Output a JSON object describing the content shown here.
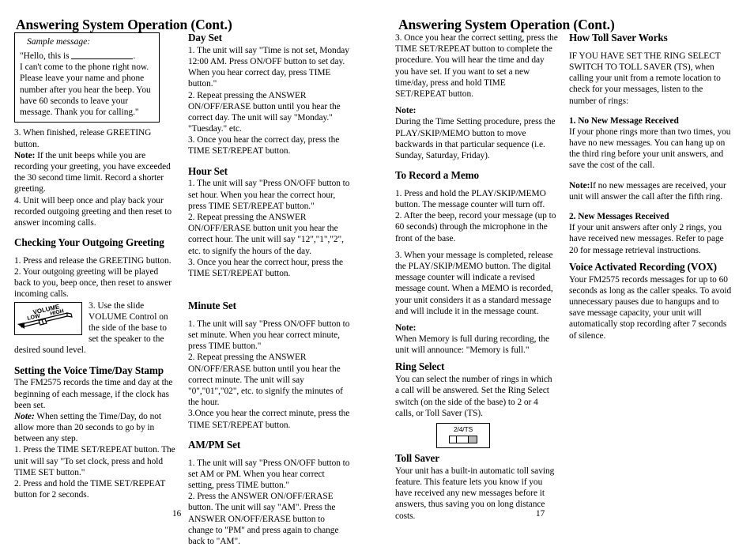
{
  "spread": {
    "left_page": {
      "title": "Answering System Operation (Cont.)",
      "page_number": "16",
      "sample_box": {
        "label": "Sample message:",
        "line1_prefix": "\"Hello, this is ",
        "line1_suffix": ".",
        "body": "I can't come to the phone right now. Please leave your name and phone number after you hear the beep. You have 60 seconds to leave your message. Thank you for calling.\""
      },
      "col1": {
        "step3": "3. When finished, release GREETING button.",
        "note_label": "Note:",
        "note_text": " If the unit beeps while you are recording your greeting, you have exceeded the 30 second time limit. Record a shorter greeting.",
        "step4": "4. Unit will beep once and play back your recorded outgoing greeting and then reset to answer incoming calls.",
        "heading_checking": "Checking Your Outgoing Greeting",
        "check_step1": "1. Press and release the GREETING button.",
        "check_step2": "2. Your outgoing greeting will be played back to you, beep once, then reset to answer incoming calls.",
        "check_step3": "3. Use the slide VOLUME Control on the side of the base to set the speaker to the desired sound level.",
        "volume_figure": {
          "title": "VOLUME",
          "low": "LOW",
          "high": "HIGH"
        },
        "heading_timestamp": "Setting the Voice Time/Day Stamp",
        "ts_intro": "The FM2575 records the time and day at the beginning of each message, if the clock has been set.",
        "ts_note_label": "Note:",
        "ts_note_text": " When setting the Time/Day, do not allow more than 20 seconds to go by in between any step.",
        "ts_step1": "1. Press the TIME SET/REPEAT button. The unit will say \"To set clock, press and hold TIME SET button.\"",
        "ts_step2": "2. Press and hold the TIME SET/REPEAT button for 2 seconds."
      },
      "col2": {
        "heading_day": "Day Set",
        "day_step1": "1.  The unit will say \"Time is not set, Monday 12:00 AM. Press ON/OFF button to set day. When you hear correct day, press TIME button.\"",
        "day_step2": "2. Repeat pressing the ANSWER ON/OFF/ERASE button until you hear the correct day. The unit will say \"Monday.\" \"Tuesday.\" etc.",
        "day_step3": "3. Once you hear the correct day, press the TIME SET/REPEAT button.",
        "heading_hour": "Hour Set",
        "hour_step1": "1. The unit will say \"Press ON/OFF button to set hour. When you hear the correct hour, press TIME SET/REPEAT button.\"",
        "hour_step2": "2. Repeat pressing the ANSWER ON/OFF/ERASE button unit you hear the correct hour. The unit will say \"12\",\"1\",\"2\", etc. to signify the hours of the day.",
        "hour_step3": "3. Once you hear the correct hour, press the TIME SET/REPEAT button.",
        "heading_minute": "Minute Set",
        "minute_step1": "1. The unit will say \"Press ON/OFF button to set minute. When you hear correct minute, press TIME button.\"",
        "minute_step2": "2. Repeat pressing the ANSWER ON/OFF/ERASE button until you hear the correct minute. The unit will say \"0\",\"01\",\"02\", etc. to signify the minutes of the hour.",
        "minute_step3": "3.Once you hear the correct minute, press the TIME SET/REPEAT button.",
        "heading_ampm": "AM/PM Set",
        "ampm_step1": "1. The unit will say \"Press ON/OFF button to set AM or PM. When you hear correct setting, press TIME button.\"",
        "ampm_step2": "2. Press the ANSWER ON/OFF/ERASE button. The unit will say \"AM\". Press the ANSWER ON/OFF/ERASE button to change to \"PM\" and press again to change back to \"AM\"."
      }
    },
    "right_page": {
      "title": "Answering System Operation (Cont.)",
      "page_number": "17",
      "col3": {
        "step3": "3. Once you hear the correct setting, press the TIME SET/REPEAT button to complete the procedure. You will hear the time and day you have set. If you want to set a new time/day, press and hold TIME SET/REPEAT button.",
        "note_label": "Note:",
        "note_text": "During the Time Setting procedure, press the PLAY/SKIP/MEMO button to move backwards in that particular sequence (i.e. Sunday, Saturday, Friday).",
        "heading_memo": "To Record a Memo",
        "memo_step1": "1.  Press and hold the PLAY/SKIP/MEMO button. The message counter will turn off.",
        "memo_step2": "2.  After the beep, record your message (up to 60 seconds) through the microphone in the front of the base.",
        "memo_step3": "3.  When your message is completed, release the PLAY/SKIP/MEMO button. The digital message counter will indicate a revised message count. When a MEMO is recorded, your unit considers it as a standard message and will include it in the message count.",
        "memo_note_label": "Note:",
        "memo_note_text": "When Memory is full during recording, the unit will announce: \"Memory is full.\"",
        "heading_ring": "Ring Select",
        "ring_text": "You can select the number of rings in which a call will be answered.  Set the Ring Select switch (on the side of the base) to 2 or 4 calls, or Toll Saver (TS).",
        "ring_switch_label": "2/4/TS",
        "heading_toll": "Toll Saver",
        "toll_text": "Your unit has a built-in automatic toll saving feature.  This feature lets you know if you have received any new messages before it answers, thus saving you on long distance costs."
      },
      "col4": {
        "heading_how_toll": "How Toll Saver Works",
        "how_toll_text": "IF YOU HAVE SET THE RING SELECT SWITCH TO TOLL SAVER (TS), when calling your unit from a remote location to check for your messages, listen to the number of rings:",
        "item1_label": "1. No New Message Received",
        "item1_text": "If your phone rings more than two times, you have no new messages.  You can hang up on the third ring before your unit answers, and save the cost of the call.",
        "note_label": "Note:",
        "note_text": "If no new messages are received, your unit will answer the call after the fifth ring.",
        "item2_label": "2. New Messages Received",
        "item2_text": "If your unit answers after only 2 rings, you have received new messages.  Refer to page 20 for message retrieval instructions.",
        "heading_vox": "Voice Activated Recording (VOX)",
        "vox_text": "Your FM2575 records messages for up to 60 seconds as long as the caller speaks. To avoid unnecessary pauses due to hangups and to save message capacity, your unit will automatically stop recording after 7 seconds of silence."
      }
    }
  }
}
